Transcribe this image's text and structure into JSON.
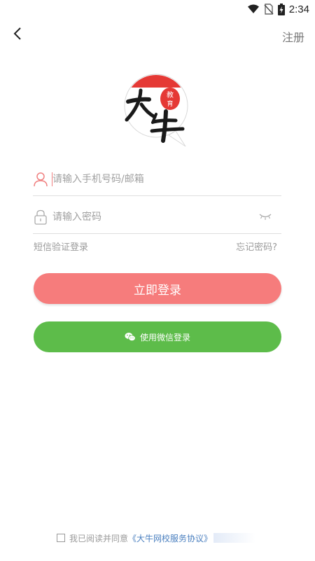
{
  "status_bar": {
    "time": "2:34",
    "icons": [
      "wifi-icon",
      "no-sim-icon",
      "battery-charging-icon"
    ]
  },
  "nav": {
    "back_icon": "back-arrow-icon",
    "register_label": "注册"
  },
  "logo": {
    "main_text": "大牛",
    "seal_text": "教育",
    "colors": {
      "red": "#e53935",
      "ink": "#1a1a1a"
    }
  },
  "form": {
    "account": {
      "placeholder": "请输入手机号码/邮箱",
      "value": "",
      "icon": "user-icon"
    },
    "password": {
      "placeholder": "请输入密码",
      "value": "",
      "icon": "lock-icon",
      "toggle_icon": "eye-closed-icon"
    }
  },
  "links": {
    "sms_login": "短信验证登录",
    "forgot_password": "忘记密码?"
  },
  "buttons": {
    "login": {
      "label": "立即登录",
      "color": "#f67c7c"
    },
    "wechat": {
      "label": "使用微信登录",
      "icon": "wechat-icon",
      "color": "#5dbc4a"
    }
  },
  "agreement": {
    "prefix": "我已阅读并同意",
    "link": "《大牛网校服务协议》",
    "checked": false
  }
}
